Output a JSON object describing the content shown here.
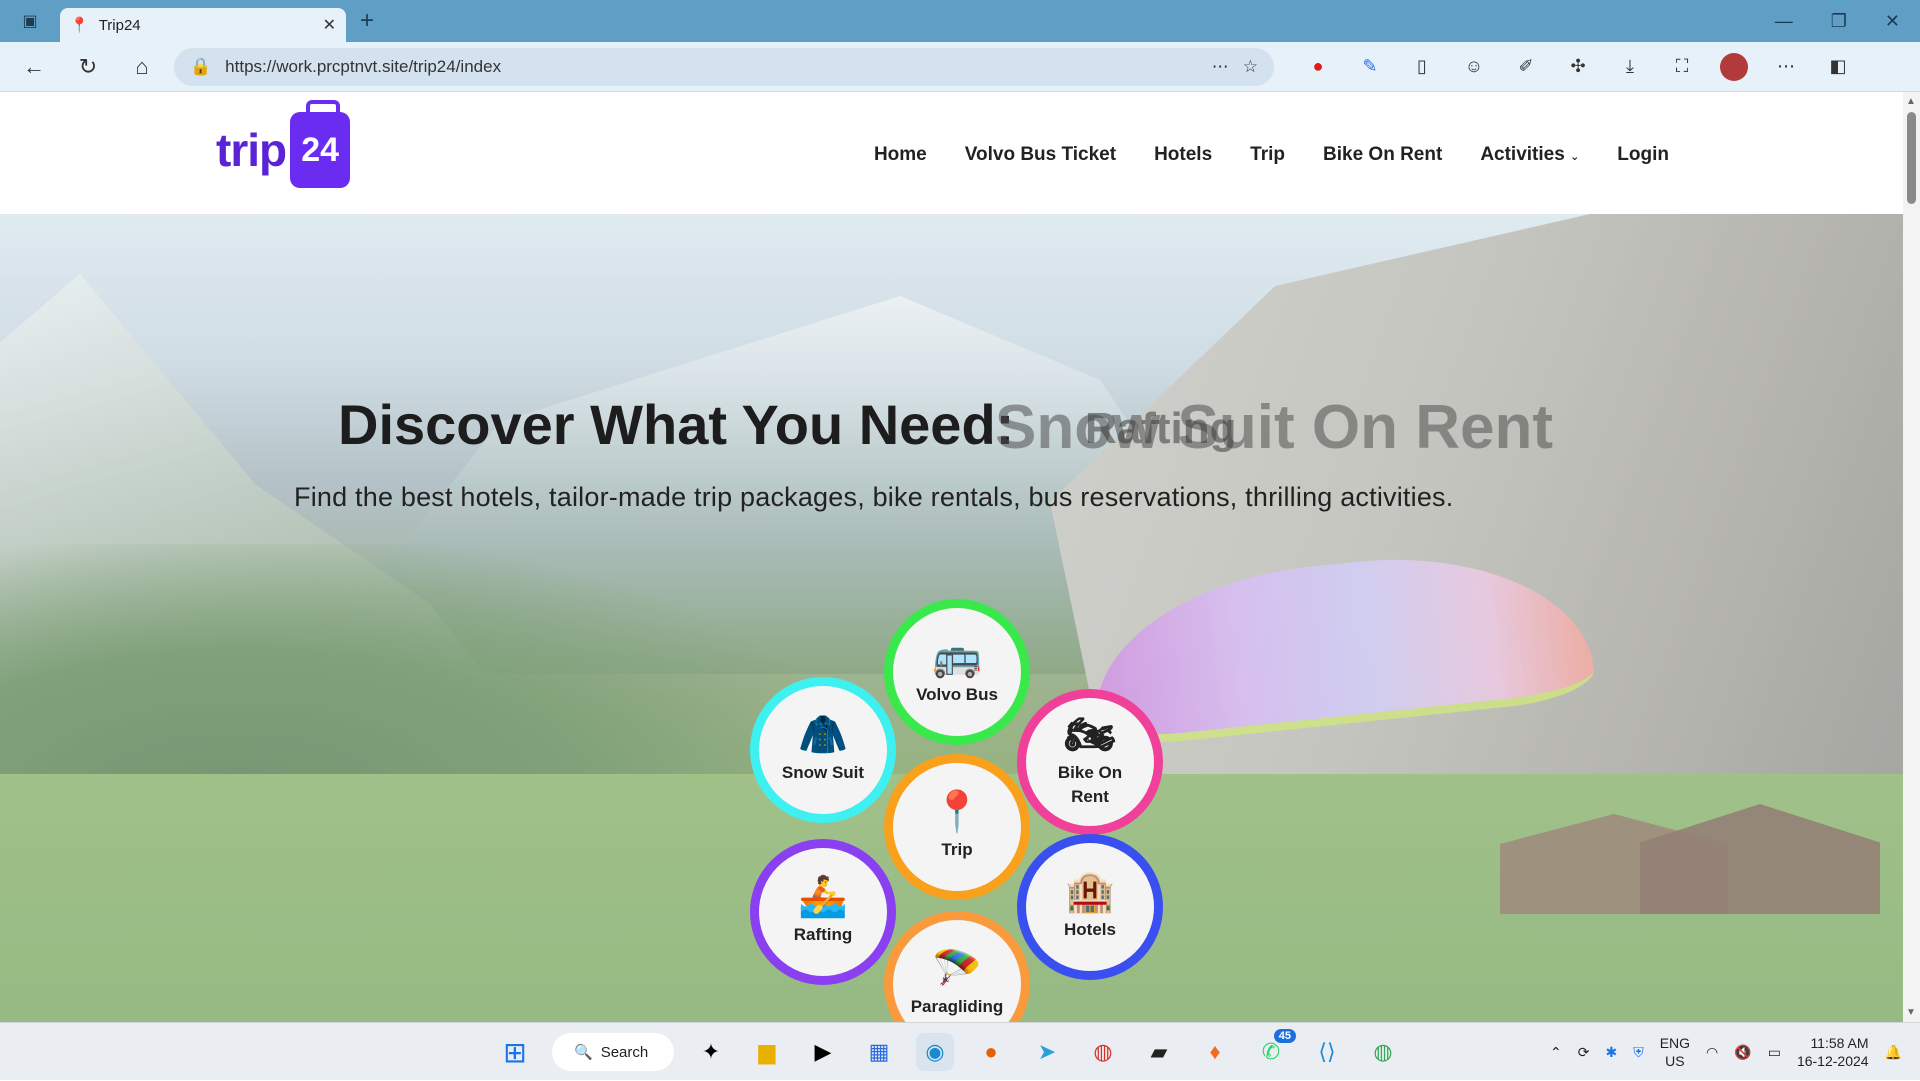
{
  "browser": {
    "tab_title": "Trip24",
    "url": "https://work.prcptnvt.site/trip24/index"
  },
  "site": {
    "logo_word": "trip",
    "logo_num": "24",
    "nav": [
      "Home",
      "Volvo Bus Ticket",
      "Hotels",
      "Trip",
      "Bike On Rent",
      "Activities",
      "Login"
    ]
  },
  "hero": {
    "title": "Discover What You Need:",
    "rotating_a": "Snow Suit On Rent",
    "rotating_b": "Rafting",
    "subtitle": "Find the best hotels, tailor-made trip packages, bike rentals, bus reservations, thrilling activities."
  },
  "services": [
    {
      "label": "Volvo Bus",
      "icon": "bus-icon",
      "glyph": "🚌",
      "color": "#39e84a"
    },
    {
      "label": "Snow Suit",
      "icon": "jacket-icon",
      "glyph": "🧥",
      "color": "#3ef0f0"
    },
    {
      "label": "Bike On Rent",
      "icon": "motorbike-icon",
      "glyph": "🏍",
      "color": "#f0409a"
    },
    {
      "label": "Trip",
      "icon": "trip-icon",
      "glyph": "📍",
      "color": "#f9a01c"
    },
    {
      "label": "Rafting",
      "icon": "raft-icon",
      "glyph": "🚣",
      "color": "#8a3ff0"
    },
    {
      "label": "Hotels",
      "icon": "hotel-icon",
      "glyph": "🏨",
      "color": "#3a4ff0"
    },
    {
      "label": "Paragliding",
      "icon": "paraglider-icon",
      "glyph": "🪂",
      "color": "#f99a3c"
    }
  ],
  "taskbar": {
    "search": "Search",
    "whatsapp_badge": "45",
    "lang": "ENG",
    "region": "US",
    "time": "11:58 AM",
    "date": "16-12-2024"
  }
}
